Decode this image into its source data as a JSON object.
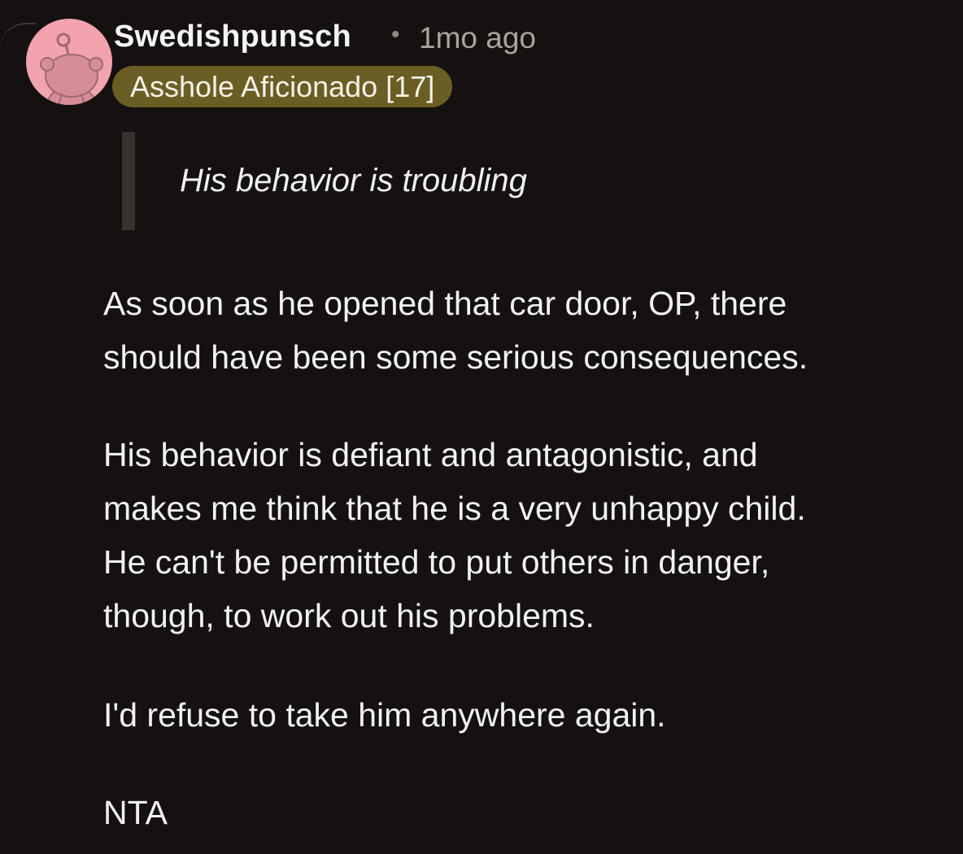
{
  "comment": {
    "author": "Swedishpunsch",
    "separator": "•",
    "age": "1mo ago",
    "flair": "Asshole Aficionado [17]",
    "avatar_icon": "snoo-avatar-icon",
    "quote": "His behavior is troubling",
    "paragraphs": [
      [
        "As soon as he opened that car door, OP, there",
        "should have been some serious consequences."
      ],
      [
        "His behavior is defiant and antagonistic, and",
        "makes me think that he is a very unhappy child.",
        "He can't be permitted to put others in danger,",
        "though, to work out his problems."
      ],
      [
        "I'd refuse to take him anywhere again."
      ],
      [
        "NTA"
      ]
    ]
  },
  "colors": {
    "background": "#141110",
    "avatar_bg": "#f2a3ae",
    "flair_bg": "#6b5e25",
    "quote_bar": "#363230"
  }
}
